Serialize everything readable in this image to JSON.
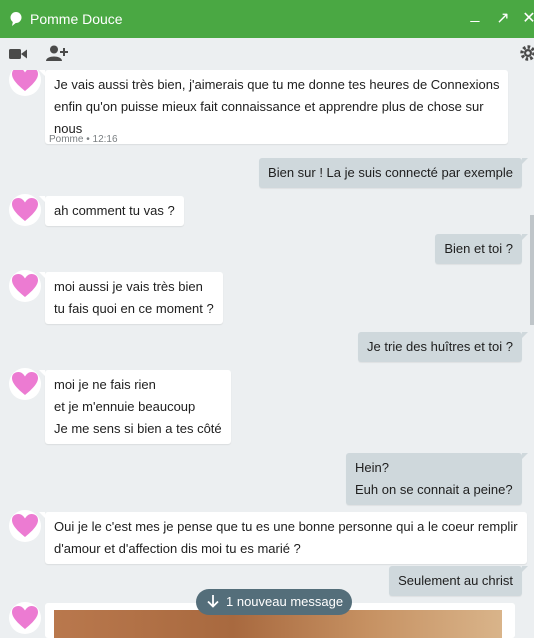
{
  "window": {
    "title": "Pomme Douce",
    "minimize": "_",
    "maximize": "↗",
    "close": "✕"
  },
  "toolbar": {
    "video_icon": "video-camera-icon",
    "add_person_icon": "add-person-icon",
    "settings_icon": "gear-icon"
  },
  "colors": {
    "titlebar": "#4aa843",
    "incoming_bubble": "#ffffff",
    "outgoing_bubble": "#cfd8dc",
    "background": "#eceff1",
    "pill": "#546e7a"
  },
  "messages": [
    {
      "dir": "in",
      "lines": [
        "Je vais aussi très bien, j'aimerais que tu me donne tes heures de Connexions",
        "enfin qu'on puisse mieux fait connaissance et apprendre plus de chose sur",
        "nous"
      ],
      "meta": "Pomme • 12:16"
    },
    {
      "dir": "out",
      "lines": [
        "Bien sur ! La je suis connecté par exemple"
      ]
    },
    {
      "dir": "in",
      "lines": [
        "ah comment tu vas ?"
      ]
    },
    {
      "dir": "out",
      "lines": [
        "Bien et toi ?"
      ]
    },
    {
      "dir": "in",
      "lines": [
        "moi aussi je vais très bien",
        "tu fais quoi en ce moment ?"
      ]
    },
    {
      "dir": "out",
      "lines": [
        "Je trie des huîtres et toi ?"
      ]
    },
    {
      "dir": "in",
      "lines": [
        "moi je ne fais rien",
        "et je m'ennuie beaucoup",
        "Je me sens si bien a tes côté"
      ]
    },
    {
      "dir": "out",
      "lines": [
        "Hein?",
        "Euh on se connait a peine?"
      ]
    },
    {
      "dir": "in",
      "lines": [
        "Oui je le c'est mes je pense que tu es une bonne personne qui a le coeur remplir",
        "d'amour et d'affection dis moi tu es marié ?"
      ]
    },
    {
      "dir": "out",
      "lines": [
        "Seulement au christ"
      ]
    }
  ],
  "new_message_pill": {
    "label": "1 nouveau message"
  }
}
